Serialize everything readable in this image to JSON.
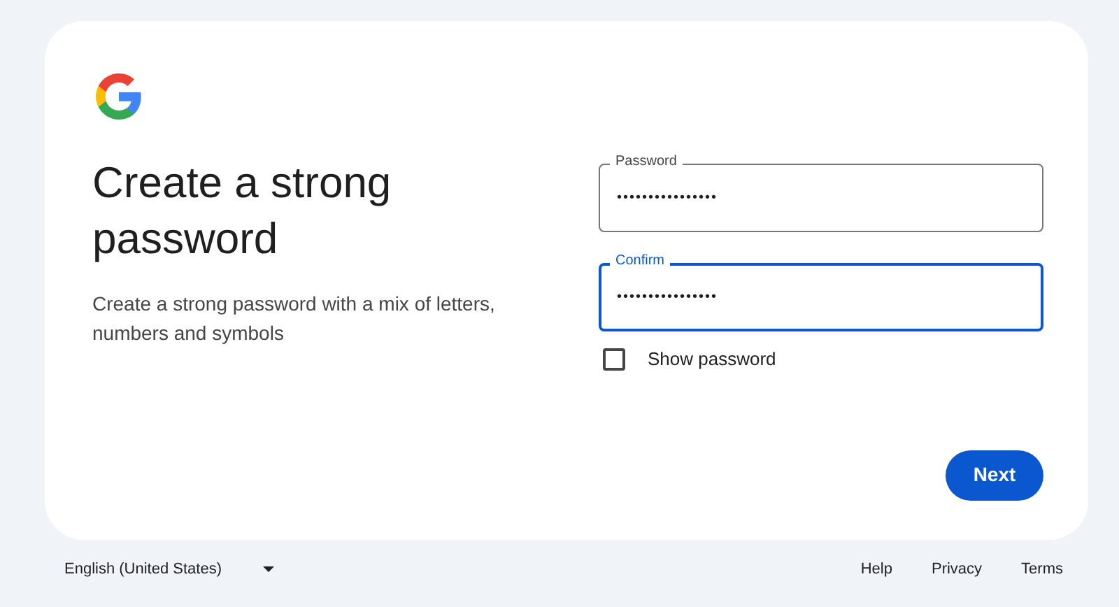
{
  "heading": "Create a strong password",
  "description": "Create a strong password with a mix of letters, numbers and symbols",
  "fields": [
    {
      "label": "Password",
      "value": "••••••••••••••••",
      "focused": false
    },
    {
      "label": "Confirm",
      "value": "••••••••••••••••",
      "focused": true
    }
  ],
  "show_password": {
    "label": "Show password",
    "checked": false
  },
  "next_button": "Next",
  "footer": {
    "language": "English (United States)",
    "links": [
      "Help",
      "Privacy",
      "Terms"
    ]
  }
}
